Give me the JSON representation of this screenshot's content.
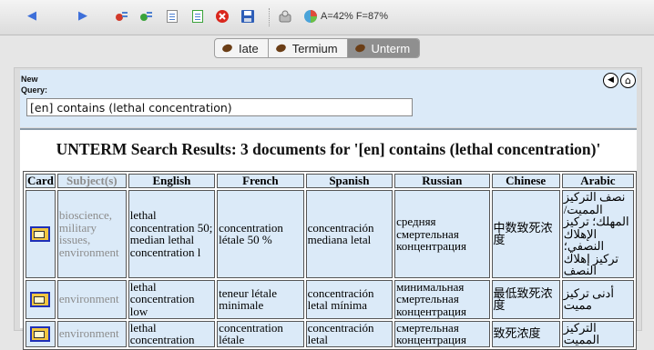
{
  "toolbar": {
    "status": "A=42% F=87%",
    "icons": [
      "back-icon",
      "forward-icon",
      "remove-term-icon",
      "add-term-icon",
      "document-icon",
      "document-list-icon",
      "stop-icon",
      "save-icon",
      "tools-icon",
      "statistics-icon"
    ]
  },
  "tabs": [
    {
      "label": "Iate",
      "active": false
    },
    {
      "label": "Termium",
      "active": false
    },
    {
      "label": "Unterm",
      "active": true
    }
  ],
  "query": {
    "label_line1": "New",
    "label_line2": "Query:",
    "value": "[en] contains (lethal concentration)"
  },
  "nav_buttons": {
    "back_glyph": "◀",
    "home_glyph": "⌂"
  },
  "results": {
    "title": "UNTERM Search Results: 3 documents for '[en] contains (lethal concentration)'",
    "columns": [
      "Card",
      "Subject(s)",
      "English",
      "French",
      "Spanish",
      "Russian",
      "Chinese",
      "Arabic"
    ],
    "rows": [
      {
        "subject": "bioscience, military issues, environment",
        "english": "lethal concentration 50; median lethal concentration l",
        "french": "concentration létale 50 %",
        "spanish": "concentración mediana letal",
        "russian": "средняя смертельная концентрация",
        "chinese": "中数致死浓度",
        "arabic": "نصف التركيز المميت/المهلك؛ تركيز الإهلاك النصفي؛ تركيز إهلاك النصف"
      },
      {
        "subject": "environment",
        "english": "lethal concentration low",
        "french": "teneur létale minimale",
        "spanish": "concentración letal mínima",
        "russian": "минимальная смертельная концентрация",
        "chinese": "最低致死浓度",
        "arabic": "أدنى تركيز مميت"
      },
      {
        "subject": "environment",
        "english": "lethal concentration",
        "french": "concentration létale",
        "spanish": "concentración letal",
        "russian": "смертельная концентрация",
        "chinese": "致死浓度",
        "arabic": "التركيز المميت"
      }
    ]
  }
}
